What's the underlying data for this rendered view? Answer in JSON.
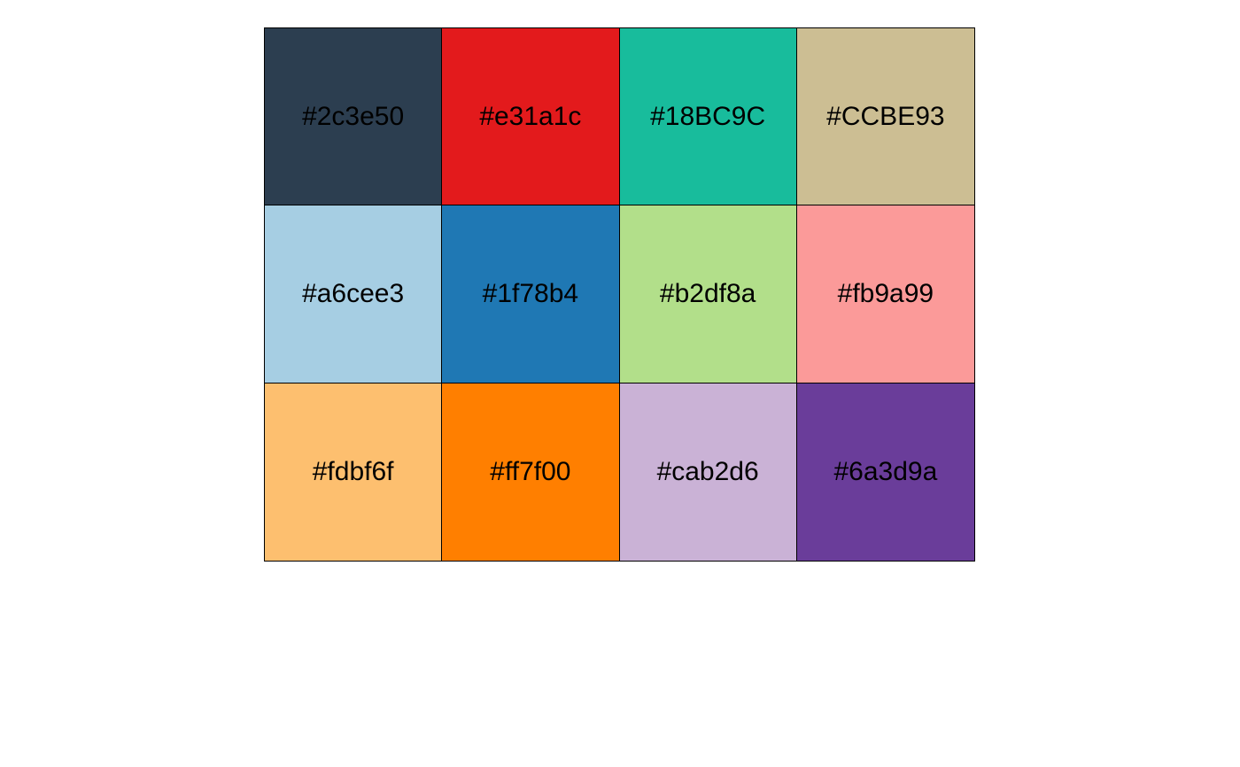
{
  "palette": {
    "swatches": [
      {
        "label": "#2c3e50",
        "color": "#2c3e50"
      },
      {
        "label": "#e31a1c",
        "color": "#e31a1c"
      },
      {
        "label": "#18BC9C",
        "color": "#18BC9C"
      },
      {
        "label": "#CCBE93",
        "color": "#CCBE93"
      },
      {
        "label": "#a6cee3",
        "color": "#a6cee3"
      },
      {
        "label": "#1f78b4",
        "color": "#1f78b4"
      },
      {
        "label": "#b2df8a",
        "color": "#b2df8a"
      },
      {
        "label": "#fb9a99",
        "color": "#fb9a99"
      },
      {
        "label": "#fdbf6f",
        "color": "#fdbf6f"
      },
      {
        "label": "#ff7f00",
        "color": "#ff7f00"
      },
      {
        "label": "#cab2d6",
        "color": "#cab2d6"
      },
      {
        "label": "#6a3d9a",
        "color": "#6a3d9a"
      }
    ]
  }
}
